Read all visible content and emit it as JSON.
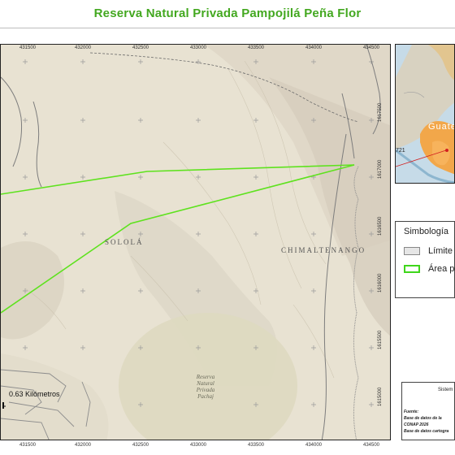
{
  "title": "Reserva Natural Privada Pampojilá Peña Flor",
  "map": {
    "x_ticks": [
      "431500",
      "432000",
      "432500",
      "433000",
      "433500",
      "434000",
      "434500"
    ],
    "y_ticks": [
      "1617500",
      "1617000",
      "1616500",
      "1616000",
      "1615500",
      "1615000"
    ],
    "department_labels": [
      "SOLOLÁ",
      "CHIMALTENANGO"
    ],
    "reserve_label": [
      "Reserva",
      "Natural",
      "Privada",
      "Pachaj"
    ],
    "scale_text": "0.63 Kilómetros",
    "polygon_color": "#5ee21e"
  },
  "inset": {
    "label": "Guate",
    "number": "721"
  },
  "legend": {
    "title": "Simbología",
    "items": [
      {
        "label": "Límite",
        "swatch_fill": "#e6e6e6",
        "swatch_border": "#888888"
      },
      {
        "label": "Área pr",
        "swatch_fill": "#ffffff",
        "swatch_border": "#3fd61b"
      }
    ]
  },
  "info": {
    "title": "Sistem",
    "lines": [
      "Fuente:",
      "Base de datos de la",
      "CONAP 2026",
      "Base de datos cartogra"
    ]
  }
}
